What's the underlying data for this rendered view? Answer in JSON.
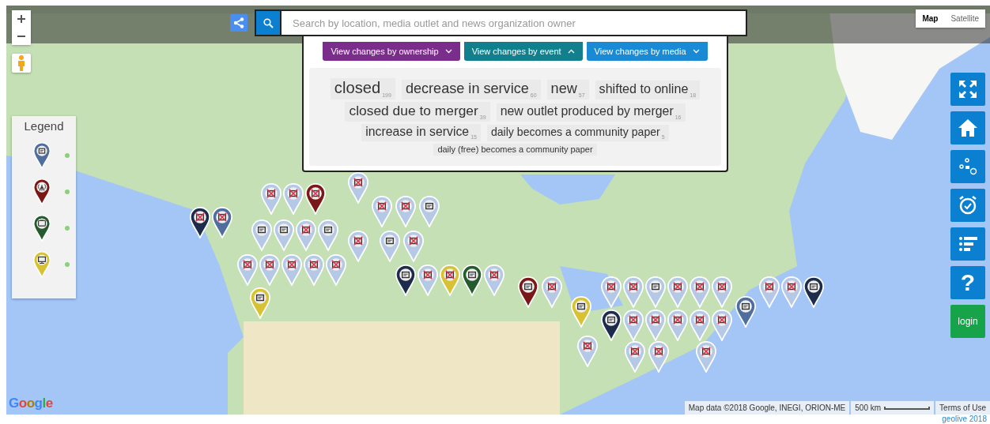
{
  "map_type": [
    {
      "label": "Map",
      "selected": true
    },
    {
      "label": "Satellite",
      "selected": false
    }
  ],
  "search": {
    "placeholder": "Search by location, media outlet and news organization owner"
  },
  "view_menus": [
    {
      "label": "View changes by ownership",
      "color": "#7b2d8b",
      "expanded": false
    },
    {
      "label": "View changes by event",
      "color": "#127f8c",
      "expanded": true
    },
    {
      "label": "View changes by media",
      "color": "#1a8ad4",
      "expanded": false
    }
  ],
  "tags": [
    {
      "label": "closed",
      "count": "199"
    },
    {
      "label": "decrease in service",
      "count": "60"
    },
    {
      "label": "new",
      "count": "57"
    },
    {
      "label": "shifted to online",
      "count": "18"
    },
    {
      "label": "closed due to merger",
      "count": "39"
    },
    {
      "label": "new outlet produced by merger",
      "count": "16"
    },
    {
      "label": "increase in service",
      "count": "15"
    },
    {
      "label": "daily becomes a community paper",
      "count": "5"
    },
    {
      "label": "daily (free) becomes a community paper"
    }
  ],
  "legend": {
    "title": "Legend",
    "items": [
      {
        "kind": "print",
        "color": "#4f6e9e"
      },
      {
        "kind": "radio",
        "color": "#7a1717"
      },
      {
        "kind": "tv",
        "color": "#245a2e"
      },
      {
        "kind": "online",
        "color": "#d6c232"
      }
    ]
  },
  "tools": [
    {
      "kind": "fullscreen"
    },
    {
      "kind": "home"
    },
    {
      "kind": "route"
    },
    {
      "kind": "clock"
    },
    {
      "kind": "list"
    },
    {
      "kind": "help",
      "label": "?"
    },
    {
      "kind": "login",
      "label": "login"
    }
  ],
  "attribution": {
    "map_data": "Map data ©2018 Google, INEGI, ORION-ME",
    "scale": "500 km",
    "terms": "Terms of Use"
  },
  "logo": "Google",
  "footer": "geolive 2018"
}
